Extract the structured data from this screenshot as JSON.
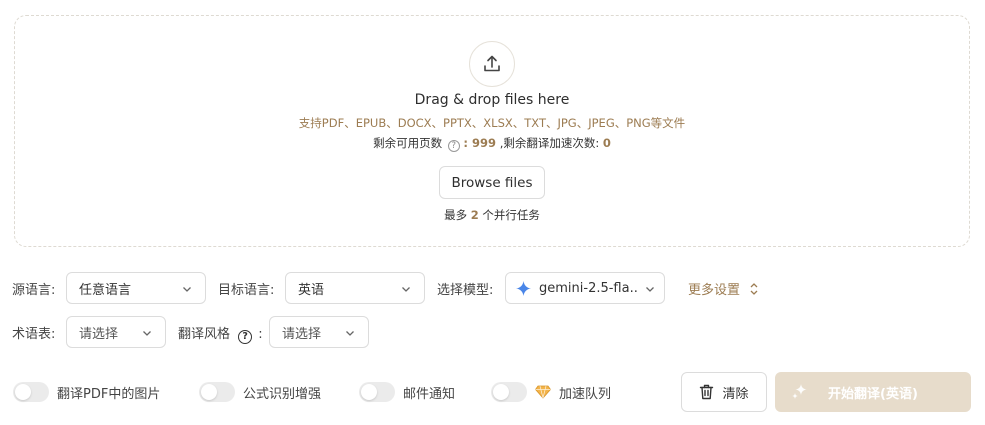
{
  "upload": {
    "title": "Drag & drop files here",
    "formats": "支持PDF、EPUB、DOCX、PPTX、XLSX、TXT、JPG、JPEG、PNG等文件",
    "pages_label": "剩余可用页数",
    "pages_value": ": 999",
    "accel_label": " ,剩余翻译加速次数: ",
    "accel_value": "0",
    "browse_label": "Browse files",
    "parallel_prefix": "最多 ",
    "parallel_value": "2",
    "parallel_suffix": " 个并行任务"
  },
  "settings": {
    "source_label": "源语言:",
    "source_value": "任意语言",
    "target_label": "目标语言:",
    "target_value": "英语",
    "model_label": "选择模型:",
    "model_value": "gemini-2.5-fla...",
    "more_label": "更多设置",
    "glossary_label": "术语表:",
    "glossary_value": "请选择",
    "style_label": "翻译风格",
    "style_value": "请选择"
  },
  "options": {
    "translate_images": "翻译PDF中的图片",
    "formula": "公式识别增强",
    "email": "邮件通知",
    "accel_queue": "加速队列"
  },
  "actions": {
    "clear_label": "清除",
    "start_label": "开始翻译(英语)"
  },
  "colors": {
    "accent": "#9c7c52",
    "start_bg": "#e7dccb",
    "gemini": "#4a86e8"
  }
}
